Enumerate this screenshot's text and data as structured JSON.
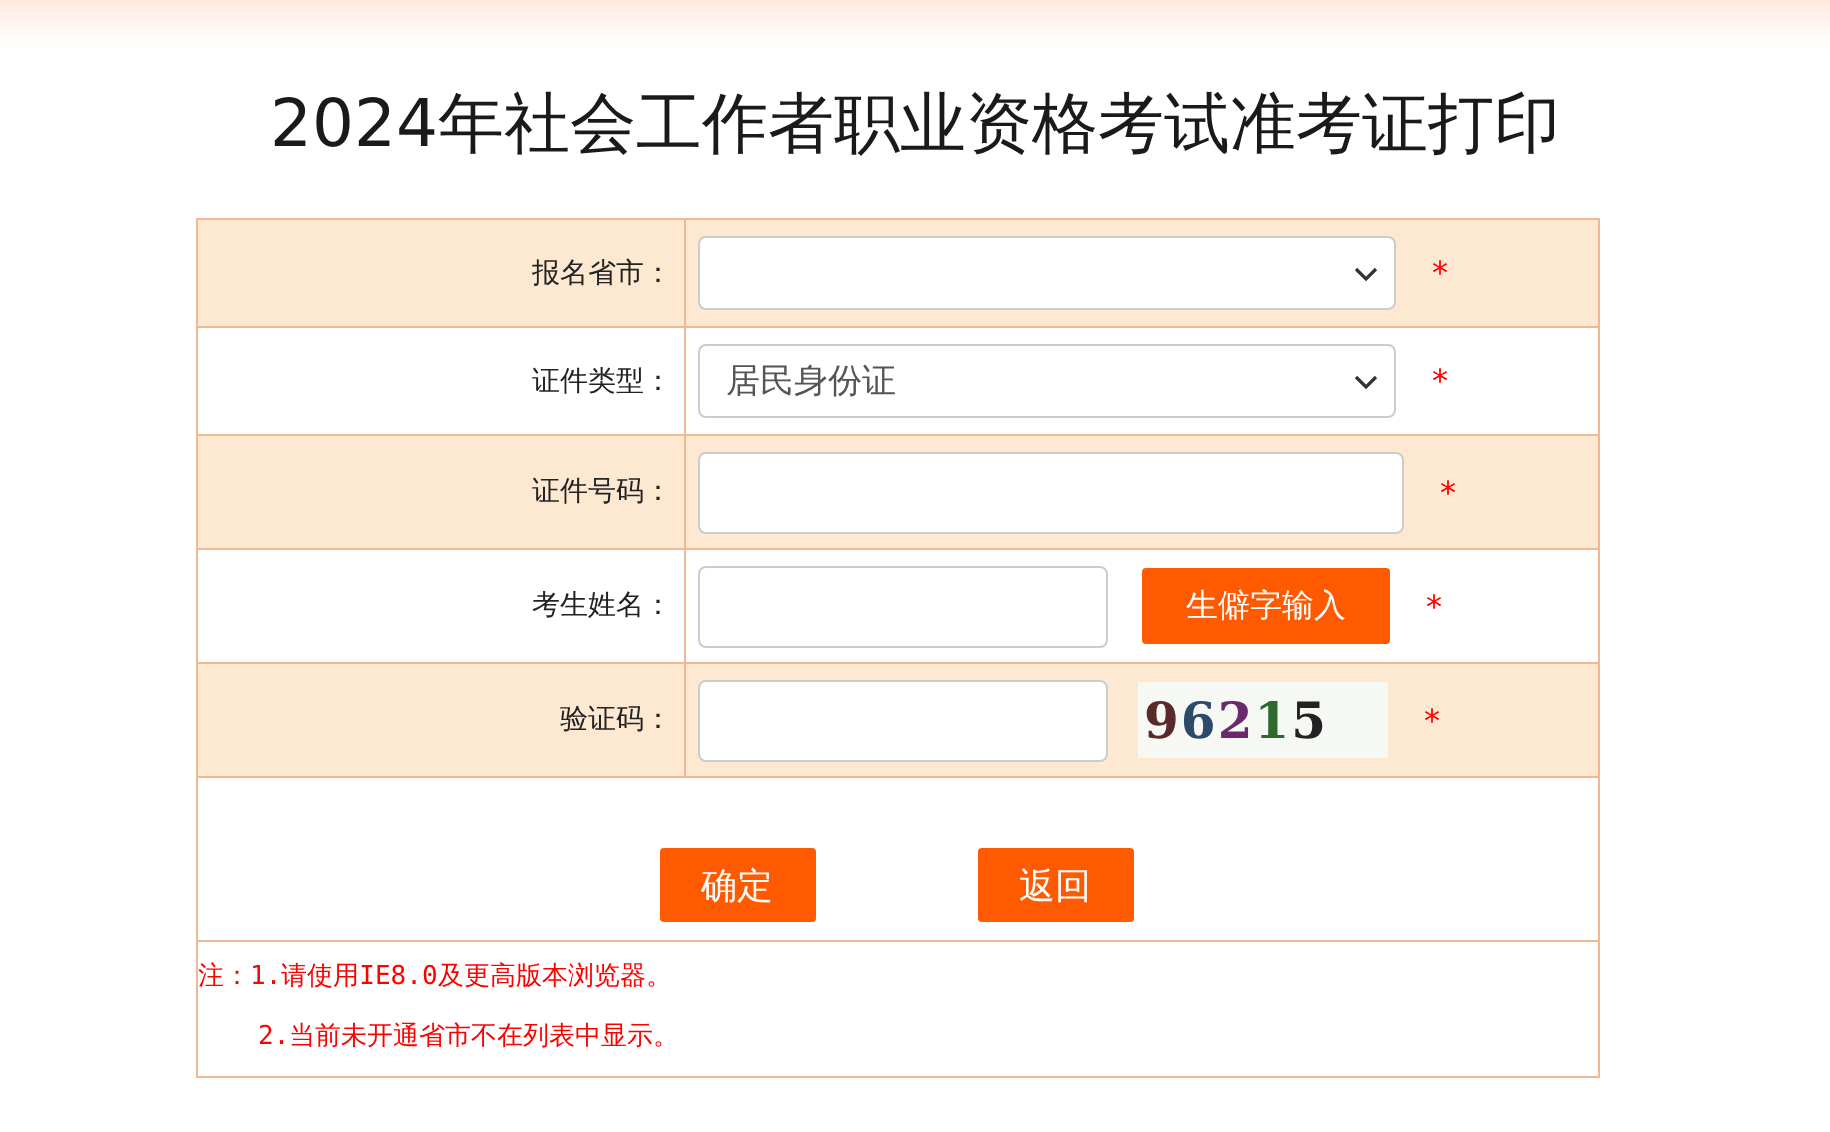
{
  "title": "2024年社会工作者职业资格考试准考证打印",
  "rows": [
    {
      "kind": "select",
      "label": "报名省市：",
      "value": "",
      "required": true,
      "shaded": true
    },
    {
      "kind": "select",
      "label": "证件类型：",
      "value": "居民身份证",
      "required": true,
      "shaded": false
    },
    {
      "kind": "input",
      "label": "证件号码：",
      "value": "",
      "required": true,
      "shaded": true
    },
    {
      "kind": "input_button",
      "label": "考生姓名：",
      "value": "",
      "button": "生僻字输入",
      "required": true,
      "shaded": false
    },
    {
      "kind": "captcha",
      "label": "验证码：",
      "value": "",
      "captcha": "96215",
      "required": true,
      "shaded": true
    }
  ],
  "required_mark": "*",
  "buttons": [
    "确定",
    "返回"
  ],
  "notes": [
    "注：1.请使用IE8.0及更高版本浏览器。",
    "2.当前未开通省市不在列表中显示。"
  ]
}
